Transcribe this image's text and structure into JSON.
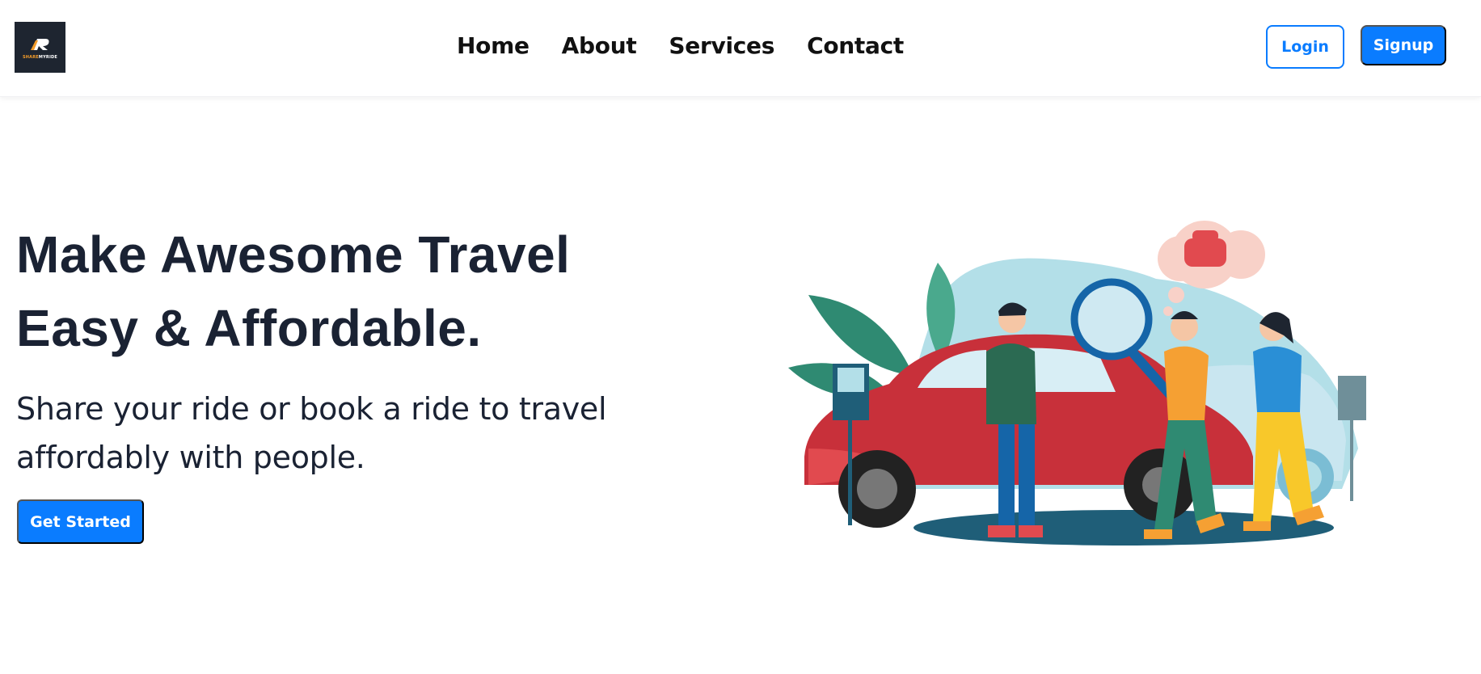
{
  "brand": {
    "logo_text_part1": "SHARE",
    "logo_text_part2": "MYRIDE",
    "logo_bg": "#1e2530",
    "accent": "#f39c2a"
  },
  "nav": {
    "links": [
      {
        "label": "Home"
      },
      {
        "label": "About"
      },
      {
        "label": "Services"
      },
      {
        "label": "Contact"
      }
    ],
    "login_label": "Login",
    "signup_label": "Signup"
  },
  "hero": {
    "title_line1": "Make Awesome Travel",
    "title_line2": "Easy & Affordable.",
    "subtitle_line1": "Share your ride or book a ride to travel",
    "subtitle_line2": "affordably with people.",
    "cta_label": "Get Started"
  },
  "colors": {
    "primary": "#0a7cff",
    "text": "#1a2233",
    "car": "#d0343a"
  },
  "illustration": {
    "icon": "ride-sharing-illustration"
  }
}
